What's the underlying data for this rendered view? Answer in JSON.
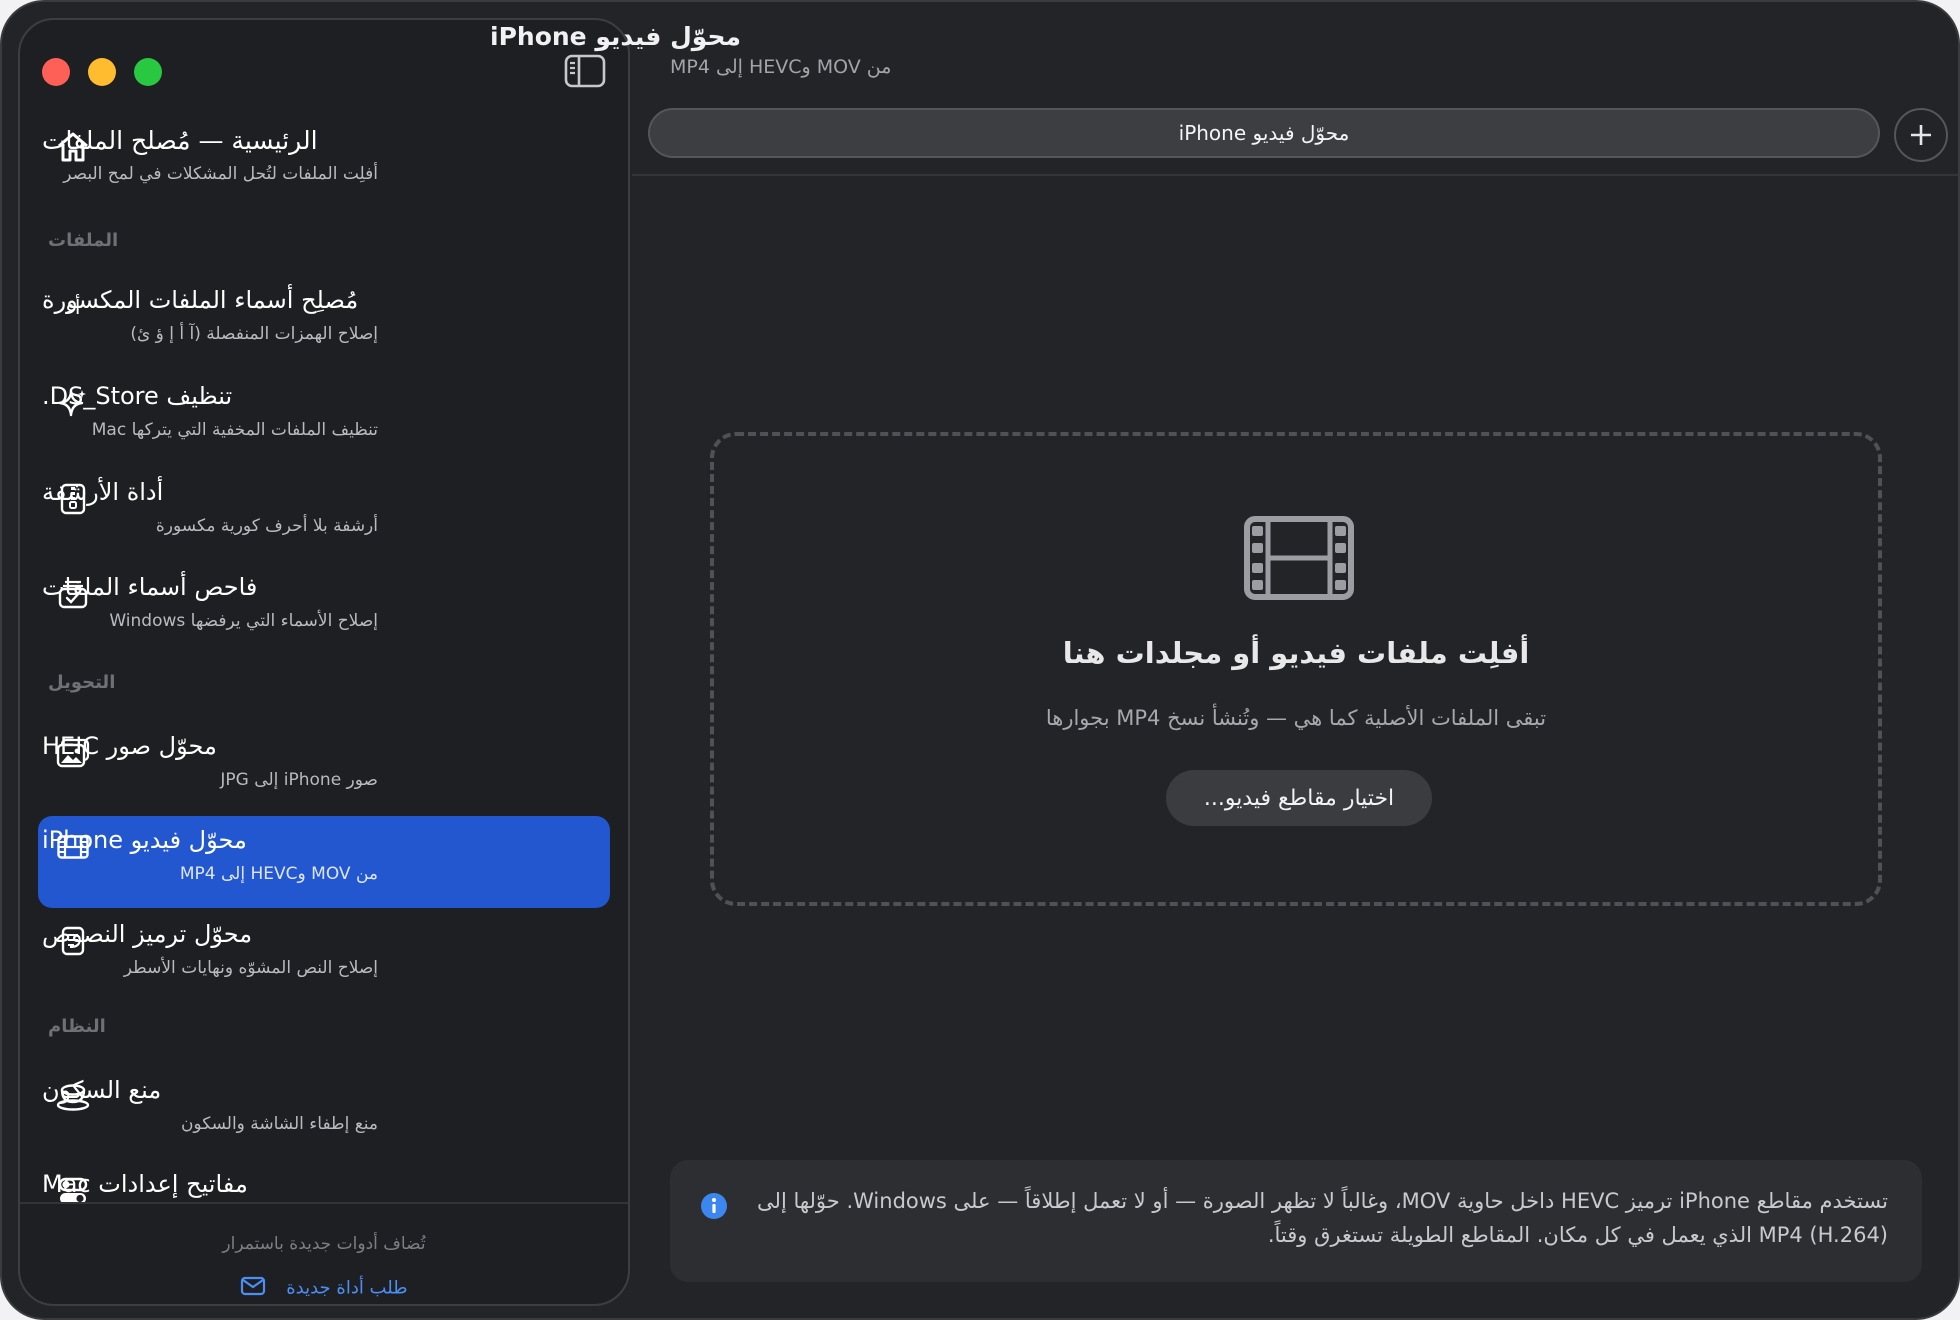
{
  "header": {
    "title": "محوّل فيديو iPhone",
    "subtitle": "من MOV وHEVC إلى MP4"
  },
  "tab": {
    "label": "محوّل فيديو iPhone"
  },
  "sidebar": {
    "home": {
      "title": "الرئيسية — مُصلح الملفات",
      "sub": "أفلِت الملفات لتُحل المشكلات في لمح البصر"
    },
    "sections": {
      "files": "الملفات",
      "convert": "التحويل",
      "system": "النظام"
    },
    "items": [
      {
        "title": "مُصلِح أسماء الملفات المكسورة",
        "sub": "إصلاح الهمزات المنفصلة (آ أ إ ؤ ئ)",
        "icon_glyph": "أء"
      },
      {
        "title": "تنظيف DS_Store.",
        "sub": "تنظيف الملفات المخفية التي يتركها Mac"
      },
      {
        "title": "أداة الأرشفة",
        "sub": "أرشفة بلا أحرف كورية مكسورة"
      },
      {
        "title": "فاحص أسماء الملفات",
        "sub": "إصلاح الأسماء التي يرفضها Windows"
      },
      {
        "title": "محوّل صور HEIC",
        "sub": "صور iPhone إلى JPG"
      },
      {
        "title": "محوّل فيديو iPhone",
        "sub": "من MOV وHEVC إلى MP4"
      },
      {
        "title": "محوّل ترميز النصوص",
        "sub": "إصلاح النص المشوّه ونهايات الأسطر"
      },
      {
        "title": "منع السكون",
        "sub": "منع إطفاء الشاشة والسكون"
      },
      {
        "title": "مفاتيح إعدادات Mac"
      }
    ],
    "footer": {
      "note": "تُضاف أدوات جديدة باستمرار",
      "link": "طلب أداة جديدة"
    }
  },
  "dropzone": {
    "title": "أفلِت ملفات فيديو أو مجلدات هنا",
    "sub": "تبقى الملفات الأصلية كما هي — وتُنشأ نسخ MP4 بجوارها",
    "button": "اختيار مقاطع فيديو..."
  },
  "info": {
    "text": "تستخدم مقاطع iPhone ترميز HEVC داخل حاوية MOV، وغالباً لا تظهر الصورة — أو لا تعمل إطلاقاً — على Windows. حوّلها إلى MP4 (H.264) الذي يعمل في كل مكان. المقاطع الطويلة تستغرق وقتاً."
  },
  "colors": {
    "accent": "#2257cf",
    "link": "#4b8ff5",
    "close": "#fe5f57",
    "minimize": "#febc2e",
    "zoom": "#28c840"
  }
}
